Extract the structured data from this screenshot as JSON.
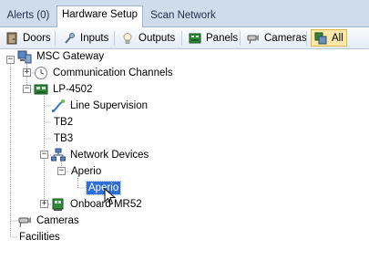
{
  "tabs": [
    {
      "label": "Alerts (0)"
    },
    {
      "label": "Hardware Setup"
    },
    {
      "label": "Scan Network"
    }
  ],
  "active_tab": "Hardware Setup",
  "filters": [
    {
      "label": "Doors",
      "icon": "door-icon"
    },
    {
      "label": "Inputs",
      "icon": "input-icon"
    },
    {
      "label": "Outputs",
      "icon": "bulb-icon"
    },
    {
      "label": "Panels",
      "icon": "panel-icon"
    },
    {
      "label": "Cameras",
      "icon": "camera-icon"
    },
    {
      "label": "All",
      "icon": "all-icon"
    }
  ],
  "active_filter": "All",
  "tree": {
    "gateway": "MSC Gateway",
    "comm_channels": "Communication Channels",
    "controller": "LP-4502",
    "line_supervision": "Line Supervision",
    "tb2": "TB2",
    "tb3": "TB3",
    "network_devices": "Network Devices",
    "aperio_group": "Aperio",
    "aperio_device": "Aperio",
    "onboard": "Onboard MR52",
    "cameras": "Cameras",
    "facilities": "Facilities"
  },
  "selected_node": "Aperio",
  "colors": {
    "tab_strip": "#cfdcec",
    "selection": "#2f6fd3",
    "toolbar_active": "#fbe7a8"
  }
}
